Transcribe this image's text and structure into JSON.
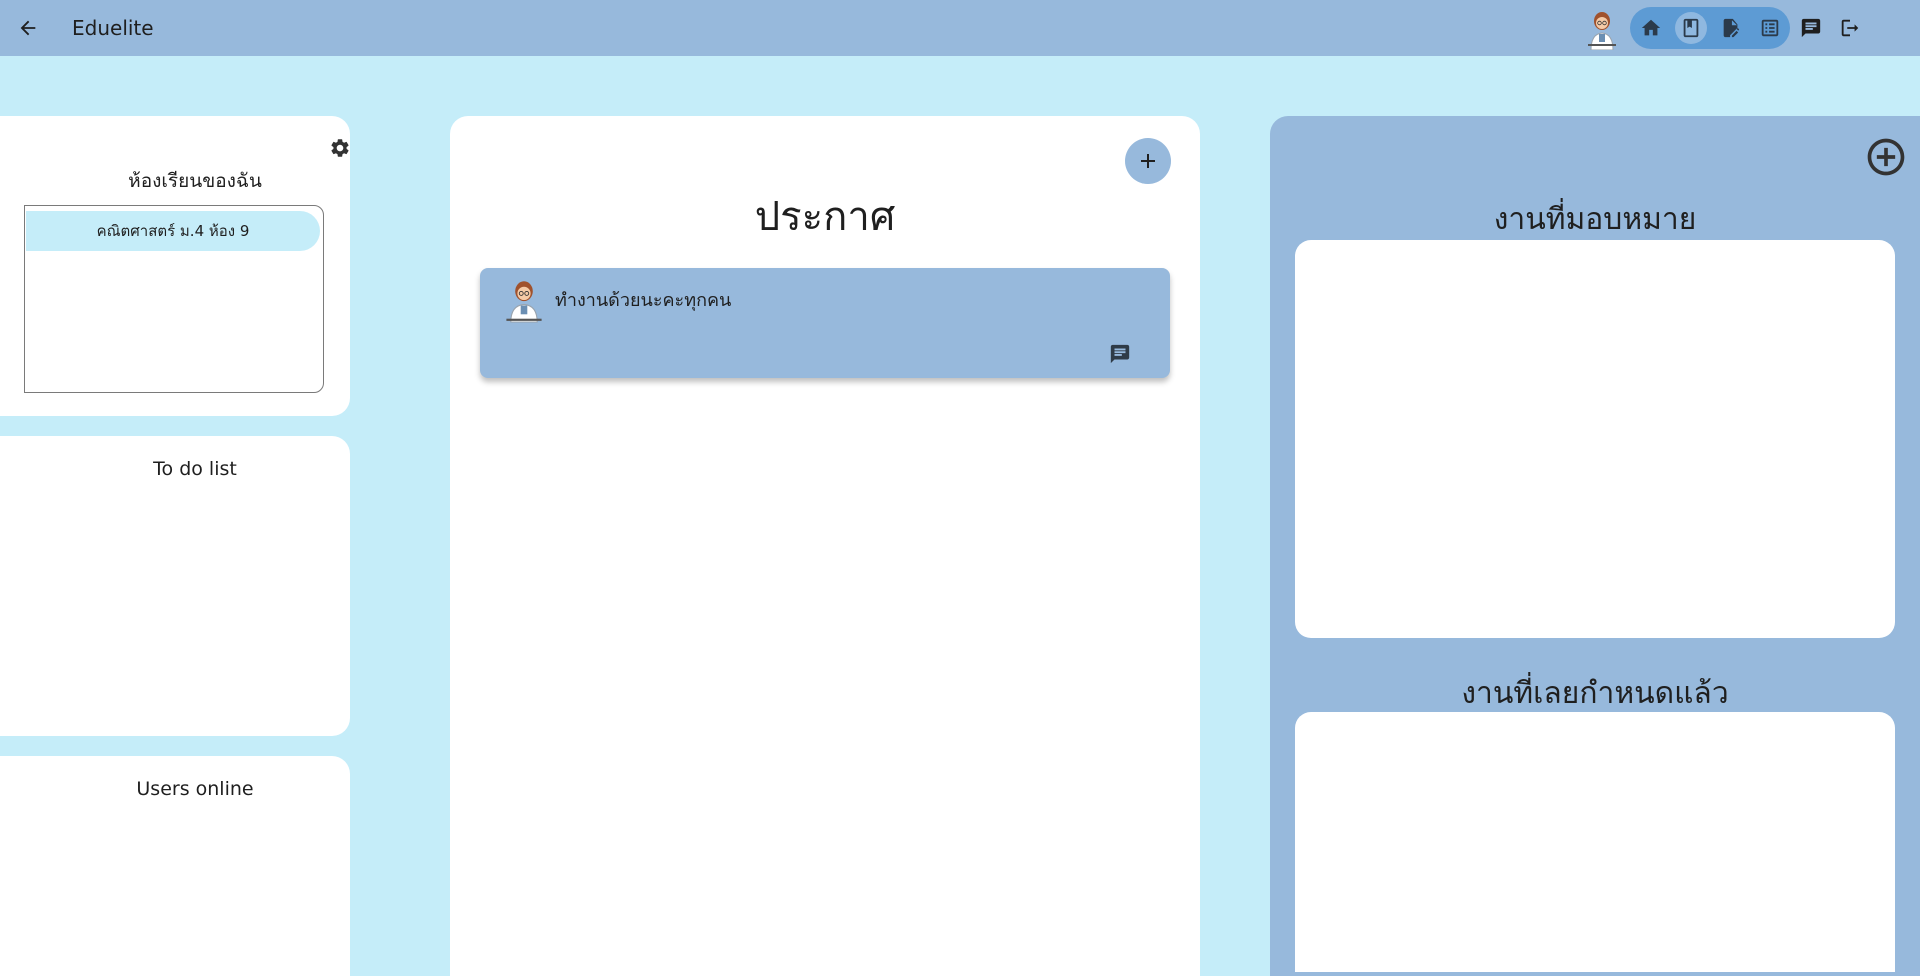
{
  "app": {
    "title": "Eduelite"
  },
  "icons": {
    "back": "arrow-back-icon",
    "home": "home-icon",
    "book": "book-icon",
    "assignment": "edit-document-icon",
    "list": "list-icon",
    "chat": "chat-icon",
    "logout": "logout-icon",
    "settings": "gear-icon",
    "add": "plus-icon",
    "add_circle": "add-circle-icon",
    "comment": "comment-icon"
  },
  "colors": {
    "page_bg": "#c5edf9",
    "appbar": "#97b9dc",
    "nav_pill": "#5d9bd4",
    "panel_blue": "#97b9dc",
    "highlight": "#c5edf9",
    "card": "#ffffff"
  },
  "left": {
    "my_classes_title": "ห้องเรียนของฉัน",
    "classes": [
      {
        "name": "คณิตศาสตร์ ม.4 ห้อง 9"
      }
    ],
    "todo_title": "To do list",
    "users_online_title": "Users online"
  },
  "announcements": {
    "title": "ประกาศ",
    "posts": [
      {
        "text": "ทำงานด้วยนะคะทุกคน"
      }
    ]
  },
  "assignments": {
    "assigned_title": "งานที่มอบหมาย",
    "overdue_title": "งานที่เลยกำหนดแล้ว"
  }
}
